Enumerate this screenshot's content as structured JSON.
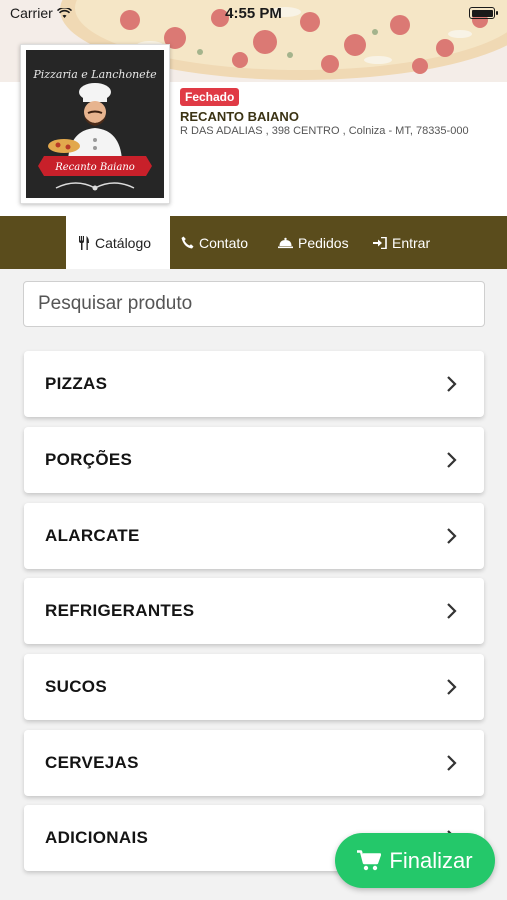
{
  "status_bar": {
    "carrier": "Carrier",
    "time": "4:55 PM"
  },
  "store": {
    "status_badge": "Fechado",
    "name": "RECANTO BAIANO",
    "address": "R DAS ADALIAS , 398 CENTRO , Colniza - MT, 78335-000",
    "logo": {
      "title_text": "Pizzaria e Lanchonete",
      "ribbon_text": "Recanto Baiano"
    }
  },
  "nav": {
    "catalog": "Catálogo",
    "contact": "Contato",
    "orders": "Pedidos",
    "login": "Entrar"
  },
  "search": {
    "placeholder": "Pesquisar produto"
  },
  "categories": [
    {
      "label": "PIZZAS"
    },
    {
      "label": "PORÇÕES"
    },
    {
      "label": "ALARCATE"
    },
    {
      "label": "REFRIGERANTES"
    },
    {
      "label": "SUCOS"
    },
    {
      "label": "CERVEJAS"
    },
    {
      "label": "ADICIONAIS"
    }
  ],
  "finalize_button": {
    "label": "Finalizar"
  },
  "colors": {
    "nav_background": "#5a4c1c",
    "badge_red": "#e03a45",
    "finalize_green": "#24c86a"
  },
  "icons": {
    "catalog": "utensils-icon",
    "contact": "phone-icon",
    "orders": "cloche-icon",
    "login": "sign-in-icon",
    "category_arrow": "chevron-right-icon",
    "finalize": "cart-icon"
  }
}
